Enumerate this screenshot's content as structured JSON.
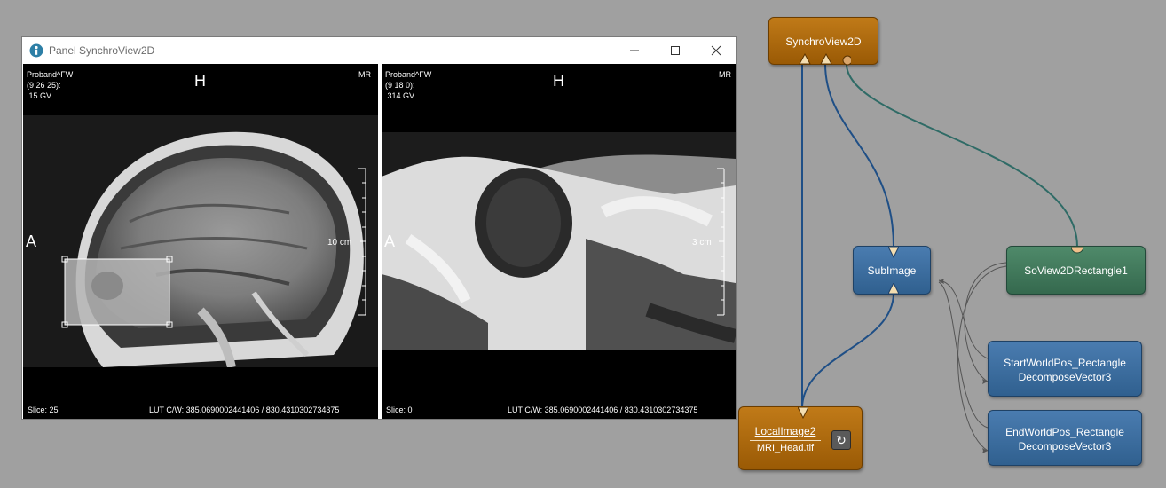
{
  "window": {
    "title": "Panel SynchroView2D"
  },
  "viewers": [
    {
      "patient": "Proband^FW",
      "coords": "(9 26 25):",
      "value": " 15 GV",
      "modality": "MR",
      "orient_top": "H",
      "orient_left": "A",
      "scale_label": "10 cm",
      "slice": "Slice: 25",
      "lut": "LUT C/W: 385.0690002441406 / 830.4310302734375"
    },
    {
      "patient": "Proband^FW",
      "coords": "(9 18 0):",
      "value": " 314 GV",
      "modality": "MR",
      "orient_top": "H",
      "orient_left": "A",
      "scale_label": "3 cm",
      "slice": "Slice: 0",
      "lut": "LUT C/W: 385.0690002441406 / 830.4310302734375"
    }
  ],
  "network": {
    "synchro": {
      "label": "SynchroView2D"
    },
    "subimage": {
      "label": "SubImage"
    },
    "sorect": {
      "label": "SoView2DRectangle1"
    },
    "startpos": {
      "line1": "StartWorldPos_Rectangle",
      "line2": "DecomposeVector3"
    },
    "endpos": {
      "line1": "EndWorldPos_Rectangle",
      "line2": "DecomposeVector3"
    },
    "local": {
      "name": "LocalImage2",
      "file": "MRI_Head.tif"
    }
  },
  "colors": {
    "connection_image": "#1f4f86",
    "connection_scene": "#2f6b66",
    "connection_field": "#555555",
    "module_orange": "#b06b0e",
    "module_blue": "#3b6fa3",
    "module_green": "#437a5c"
  },
  "icons": {
    "app": "app-logo-icon",
    "minimize": "minimize-icon",
    "maximize": "maximize-icon",
    "close": "close-icon",
    "reload": "reload-icon"
  }
}
